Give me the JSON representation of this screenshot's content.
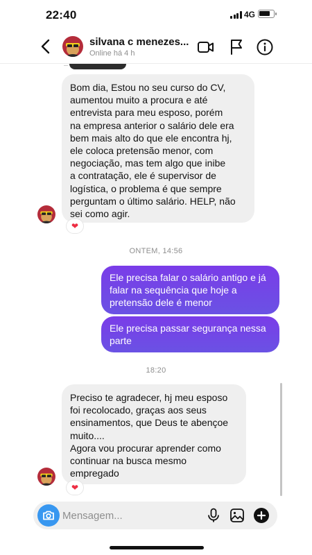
{
  "status": {
    "time": "22:40",
    "network": "4G"
  },
  "header": {
    "name": "silvana c menezes...",
    "subtitle": "Online há 4 h",
    "icons": [
      "back-icon",
      "video-call-icon",
      "flag-icon",
      "info-icon"
    ]
  },
  "messages": [
    {
      "from": "them",
      "lines": [
        "Bom dia, Estou no seu curso do CV,",
        "aumentou muito a procura  e até",
        "entrevista para meu esposo, porém",
        "na empresa anterior o salário  dele era",
        "bem mais alto  do que ele encontra hj,",
        "ele coloca pretensão  menor, com",
        "negociação,  mas tem algo que inibe",
        "a contratação,  ele é  supervisor de",
        "logística, o problema é  que sempre",
        "perguntam o último  salário. HELP, não",
        "sei como agir."
      ],
      "reaction": "heart"
    },
    {
      "timestamp": "ONTEM, 14:56"
    },
    {
      "from": "me",
      "lines": [
        "Ele precisa falar o salário antigo e já",
        "falar na sequência que hoje a",
        "pretensão dele é menor"
      ]
    },
    {
      "from": "me",
      "lines": [
        "Ele precisa passar segurança nessa",
        "parte"
      ]
    },
    {
      "timestamp": "18:20"
    },
    {
      "from": "them",
      "lines": [
        "Preciso te agradecer,  hj meu esposo",
        "foi recolocado, graças  aos seus",
        "ensinamentos, que Deus te abençoe",
        "muito....",
        "Agora vou procurar aprender como",
        "continuar na busca mesmo",
        "empregado"
      ],
      "reaction": "heart"
    }
  ],
  "composer": {
    "placeholder": "Mensagem...",
    "icons": [
      "camera-icon",
      "microphone-icon",
      "gallery-icon",
      "add-icon"
    ]
  },
  "colors": {
    "outgoing_start": "#7a3ce8",
    "outgoing_end": "#6a52e4",
    "incoming": "#efefef",
    "camera": "#3897f0",
    "reaction": "#ed2d43"
  }
}
